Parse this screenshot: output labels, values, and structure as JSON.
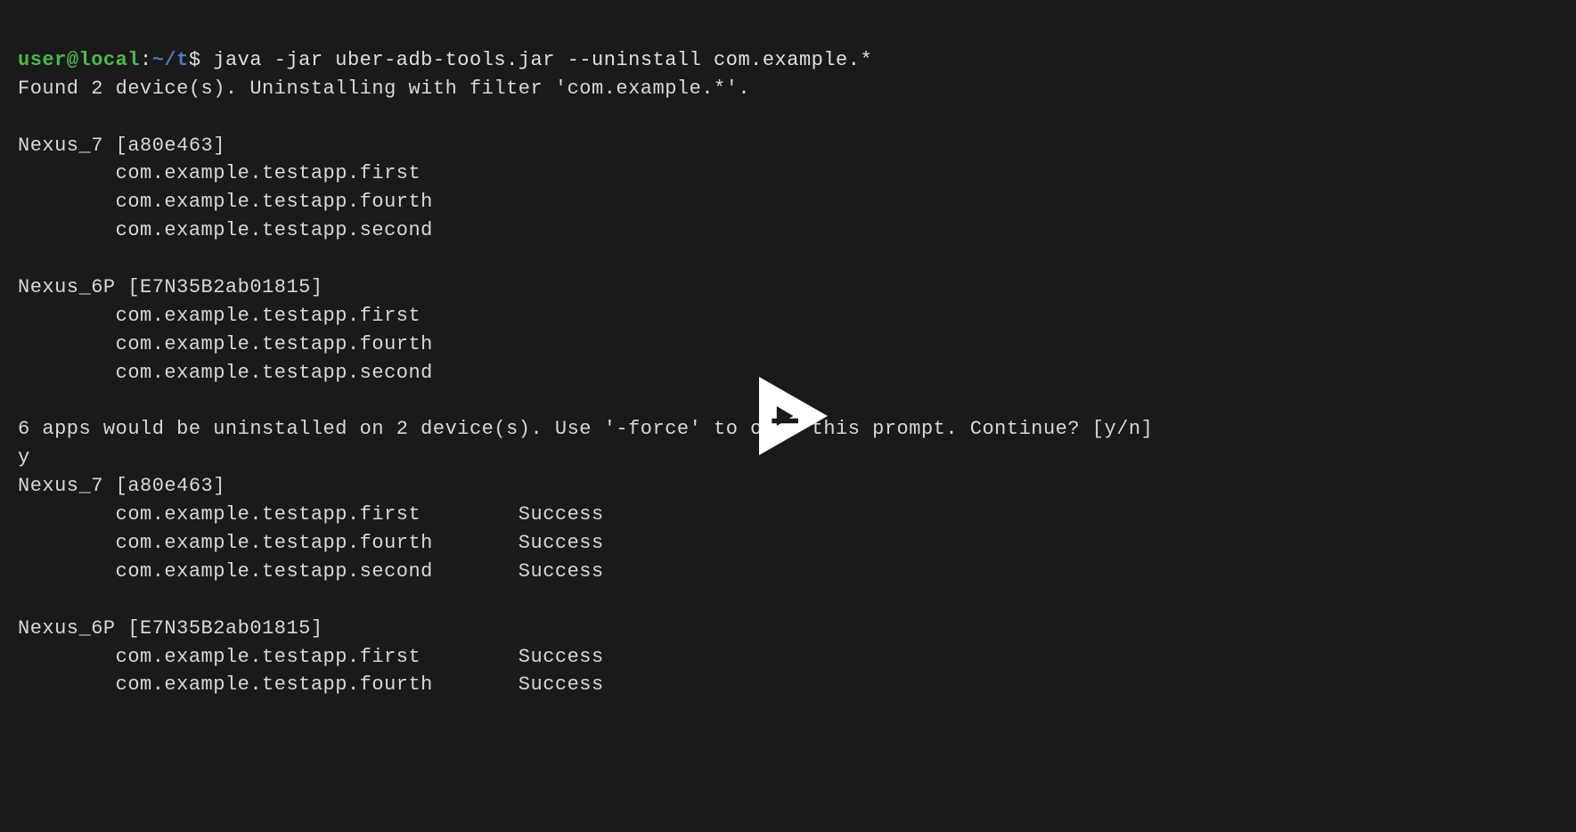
{
  "prompt": {
    "user": "user@local",
    "colon": ":",
    "path": "~/t",
    "dollar": "$"
  },
  "command": "java -jar uber-adb-tools.jar --uninstall com.example.*",
  "lines": {
    "found": "Found 2 device(s). Uninstalling with filter 'com.example.*'.",
    "blank": "",
    "device1_header": "Nexus_7 [a80e463]",
    "device1_pkg1": "com.example.testapp.first",
    "device1_pkg2": "com.example.testapp.fourth",
    "device1_pkg3": "com.example.testapp.second",
    "device2_header": "Nexus_6P [E7N35B2ab01815]",
    "device2_pkg1": "com.example.testapp.first",
    "device2_pkg2": "com.example.testapp.fourth",
    "device2_pkg3": "com.example.testapp.second",
    "confirm": "6 apps would be uninstalled on 2 device(s). Use '-force' to omit this prompt. Continue? [y/n]",
    "answer": "y",
    "result1_header": "Nexus_7 [a80e463]",
    "result1_pkg1": "com.example.testapp.first        Success",
    "result1_pkg2": "com.example.testapp.fourth       Success",
    "result1_pkg3": "com.example.testapp.second       Success",
    "result2_header": "Nexus_6P [E7N35B2ab01815]",
    "result2_pkg1": "com.example.testapp.first        Success",
    "result2_pkg2": "com.example.testapp.fourth       Success"
  },
  "play_icon": "play"
}
